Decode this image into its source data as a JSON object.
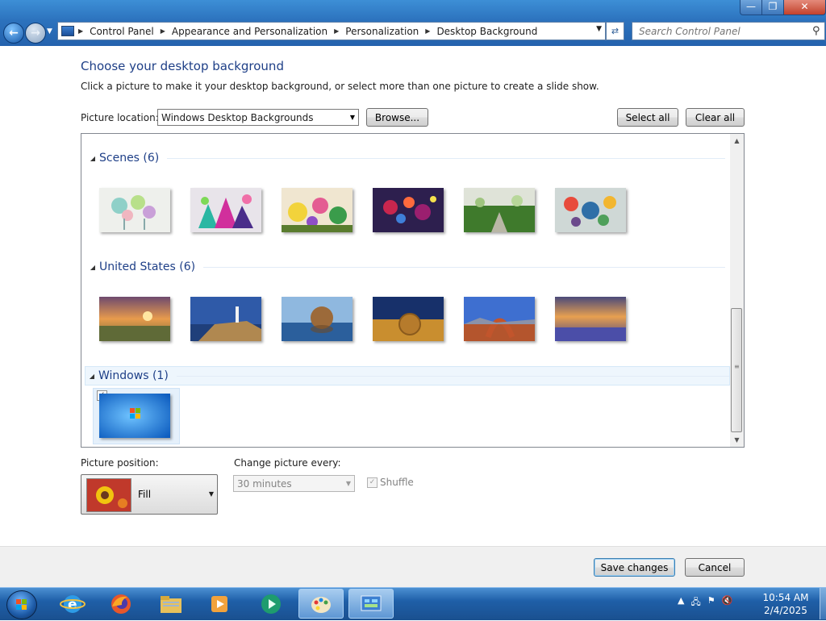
{
  "window": {
    "minimize_glyph": "—",
    "maximize_glyph": "❐",
    "close_glyph": "✕"
  },
  "nav": {
    "back_glyph": "←",
    "forward_glyph": "→",
    "breadcrumb": [
      "Control Panel",
      "Appearance and Personalization",
      "Personalization",
      "Desktop Background"
    ],
    "search_placeholder": "Search Control Panel"
  },
  "page": {
    "title": "Choose your desktop background",
    "description": "Click a picture to make it your desktop background, or select more than one picture to create a slide show.",
    "picture_location_label": "Picture location:",
    "picture_location_value": "Windows Desktop Backgrounds",
    "browse_label": "Browse...",
    "select_all_label": "Select all",
    "clear_all_label": "Clear all"
  },
  "gallery": {
    "groups": [
      {
        "name": "Scenes (6)",
        "items": [
          "scene-1",
          "scene-2",
          "scene-3",
          "scene-4",
          "scene-5",
          "scene-6"
        ]
      },
      {
        "name": "United States (6)",
        "items": [
          "us-1",
          "us-2",
          "us-3",
          "us-4",
          "us-5",
          "us-6"
        ]
      },
      {
        "name": "Windows (1)",
        "items": [
          "windows-7"
        ],
        "selected": true
      }
    ],
    "windows_item_checked": "✓"
  },
  "options": {
    "picture_position_label": "Picture position:",
    "picture_position_value": "Fill",
    "change_picture_label": "Change picture every:",
    "change_picture_value": "30 minutes",
    "shuffle_label": "Shuffle",
    "shuffle_checked": "✓"
  },
  "footer": {
    "save_label": "Save changes",
    "cancel_label": "Cancel"
  },
  "taskbar": {
    "pinned": [
      "internet-explorer",
      "firefox",
      "file-explorer",
      "media-player",
      "media-center",
      "paint",
      "control-panel"
    ],
    "time": "10:54 AM",
    "date": "2/4/2025"
  }
}
